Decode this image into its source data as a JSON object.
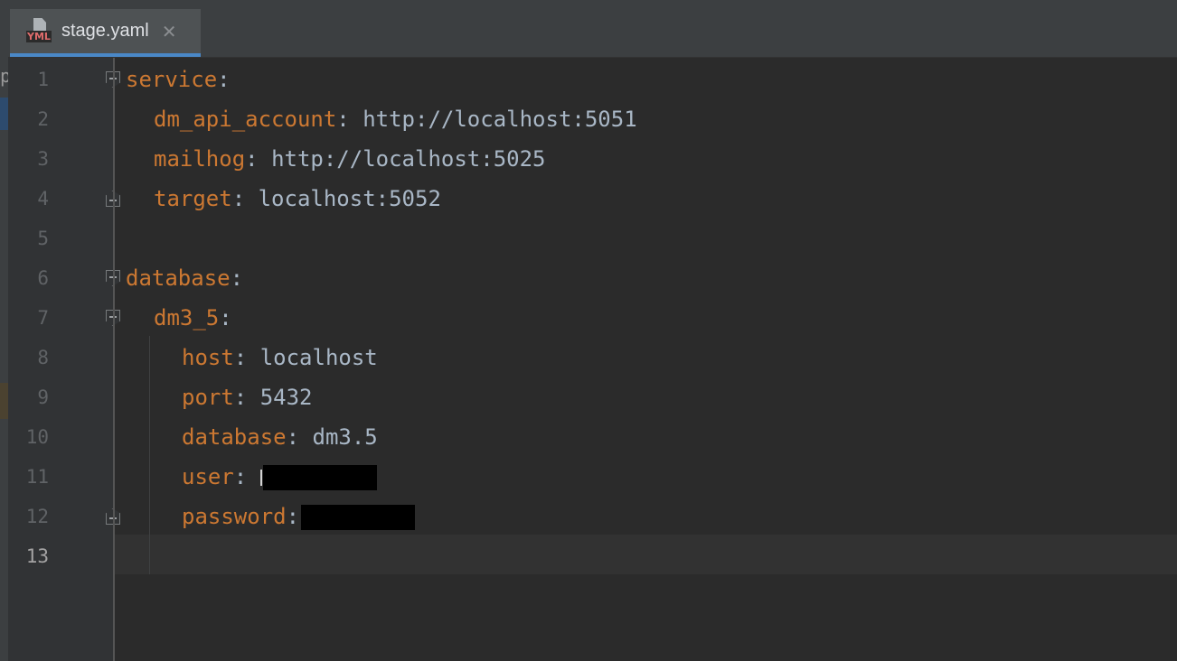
{
  "tab": {
    "filename": "stage.yaml",
    "icon_badge": "YML",
    "close_glyph": "✕"
  },
  "left_strip": {
    "partial_char": "p"
  },
  "editor": {
    "current_line": 13,
    "lines": [
      {
        "number": "1",
        "key": "service",
        "sep": ":",
        "value": ""
      },
      {
        "number": "2",
        "key": "dm_api_account",
        "sep": ": ",
        "value": "http://localhost:5051"
      },
      {
        "number": "3",
        "key": "mailhog",
        "sep": ": ",
        "value": "http://localhost:5025"
      },
      {
        "number": "4",
        "key": "target",
        "sep": ": ",
        "value": "localhost:5052"
      },
      {
        "number": "5",
        "key": "",
        "sep": "",
        "value": ""
      },
      {
        "number": "6",
        "key": "database",
        "sep": ":",
        "value": ""
      },
      {
        "number": "7",
        "key": "dm3_5",
        "sep": ":",
        "value": ""
      },
      {
        "number": "8",
        "key": "host",
        "sep": ": ",
        "value": "localhost"
      },
      {
        "number": "9",
        "key": "port",
        "sep": ": ",
        "value": "5432"
      },
      {
        "number": "10",
        "key": "database",
        "sep": ": ",
        "value": "dm3.5"
      },
      {
        "number": "11",
        "key": "user",
        "sep": ": ",
        "value": ""
      },
      {
        "number": "12",
        "key": "password",
        "sep": ":",
        "value": ""
      },
      {
        "number": "13",
        "key": "",
        "sep": "",
        "value": ""
      }
    ]
  },
  "colors": {
    "background": "#2b2b2b",
    "gutter": "#313335",
    "key": "#cc7832",
    "text": "#a9b7c6",
    "tab_active_underline": "#4a88c7",
    "redaction": "#000000"
  }
}
